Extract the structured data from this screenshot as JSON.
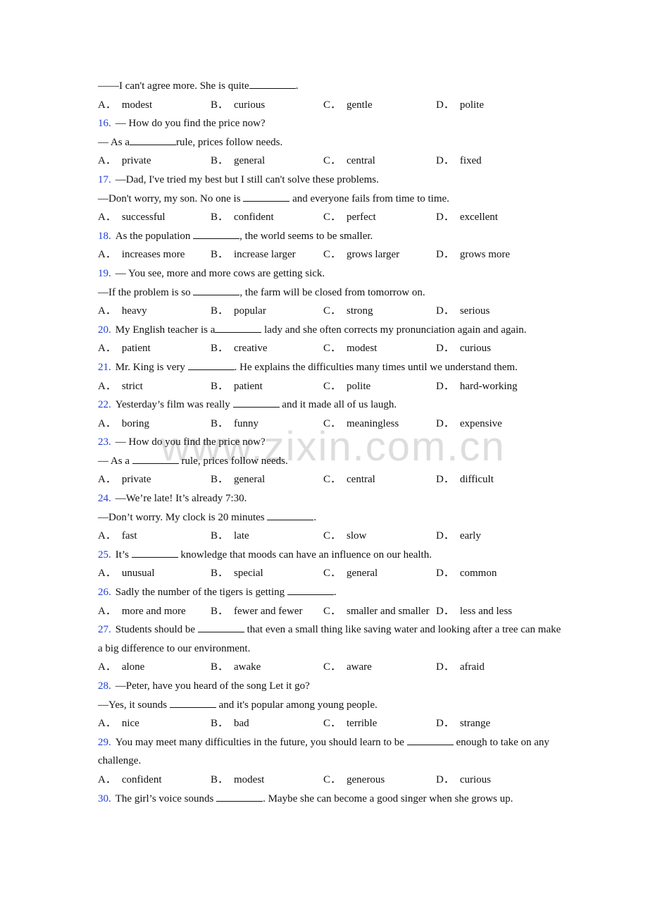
{
  "watermark": "www.zixin.com.cn",
  "intro_line": {
    "before": "——I can't agree more. She is quite",
    "after": "."
  },
  "intro_options": [
    "modest",
    "curious",
    "gentle",
    "polite"
  ],
  "option_letters": [
    "A．",
    "B．",
    "C．",
    "D．"
  ],
  "questions": [
    {
      "number": "16.",
      "lines": [
        {
          "before": "— How do you find the price now?",
          "after": ""
        },
        {
          "before": "— As a",
          "blank": true,
          "after": "rule, prices follow needs."
        }
      ],
      "options": [
        "private",
        "general",
        "central",
        "fixed"
      ]
    },
    {
      "number": "17.",
      "lines": [
        {
          "before": "—Dad, I've tried my best but I still can't solve these problems.",
          "after": ""
        },
        {
          "before": "—Don't worry, my son. No one is ",
          "blank": true,
          "after": " and everyone fails from time to time."
        }
      ],
      "options": [
        "successful",
        "confident",
        "perfect",
        "excellent"
      ]
    },
    {
      "number": "18.",
      "lines": [
        {
          "before": "As the population ",
          "blank": true,
          "after": ", the world seems to be smaller."
        }
      ],
      "options": [
        "increases more",
        "increase larger",
        "grows larger",
        "grows more"
      ]
    },
    {
      "number": "19.",
      "lines": [
        {
          "before": "— You see, more and more cows are getting sick.",
          "after": ""
        },
        {
          "before": "—If the problem is so  ",
          "blank": true,
          "after": ", the farm will be closed from tomorrow on."
        }
      ],
      "options": [
        "heavy",
        "popular",
        "strong",
        "serious"
      ]
    },
    {
      "number": "20.",
      "lines": [
        {
          "before": "My English teacher is a",
          "blank": true,
          "after": " lady and she often corrects my pronunciation again and again.",
          "wrap": true
        }
      ],
      "options": [
        "patient",
        "creative",
        "modest",
        "curious"
      ]
    },
    {
      "number": "21.",
      "lines": [
        {
          "before": "Mr. King is very ",
          "blank": true,
          "after": ". He explains the difficulties many times until we understand them."
        }
      ],
      "options": [
        "strict",
        "patient",
        "polite",
        "hard-working"
      ]
    },
    {
      "number": "22.",
      "lines": [
        {
          "before": "Yesterday’s film was really ",
          "blank": true,
          "after": " and it made all of us laugh."
        }
      ],
      "options": [
        "boring",
        "funny",
        "meaningless",
        "expensive"
      ]
    },
    {
      "number": "23.",
      "lines": [
        {
          "before": "— How do you find the price now?",
          "after": ""
        },
        {
          "before": "— As a ",
          "blank": true,
          "after": " rule, prices follow needs."
        }
      ],
      "options": [
        "private",
        "general",
        "central",
        "difficult"
      ]
    },
    {
      "number": "24.",
      "lines": [
        {
          "before": "—We’re late! It’s already 7:30.",
          "after": ""
        },
        {
          "before": "—Don’t worry. My clock is 20 minutes ",
          "blank": true,
          "after": "."
        }
      ],
      "options": [
        "fast",
        "late",
        "slow",
        "early"
      ]
    },
    {
      "number": "25.",
      "lines": [
        {
          "before": "It’s ",
          "blank": true,
          "after": " knowledge that moods can have an influence on our health."
        }
      ],
      "options": [
        "unusual",
        "special",
        "general",
        "common"
      ]
    },
    {
      "number": "26.",
      "lines": [
        {
          "before": "Sadly the number of the tigers is getting ",
          "blank": true,
          "after": "."
        }
      ],
      "options": [
        "more and more",
        "fewer and fewer",
        "smaller and smaller",
        "less and less"
      ]
    },
    {
      "number": "27.",
      "lines": [
        {
          "before": "Students should be ",
          "blank": true,
          "after": " that even a small thing like saving water and looking after a tree can make a big difference to our environment.",
          "wrap": true
        }
      ],
      "options": [
        "alone",
        "awake",
        "aware",
        "afraid"
      ]
    },
    {
      "number": "28.",
      "lines": [
        {
          "before": "—Peter, have you heard of the song Let it go?",
          "after": ""
        },
        {
          "before": "—Yes, it sounds ",
          "blank": true,
          "after": " and it's popular among young people."
        }
      ],
      "options": [
        "nice",
        "bad",
        "terrible",
        "strange"
      ]
    },
    {
      "number": "29.",
      "lines": [
        {
          "before": "You may meet many difficulties in the future, you should learn to be ",
          "blank": true,
          "after": " enough to take on any challenge.",
          "wrap": true
        }
      ],
      "options": [
        "confident",
        "modest",
        "generous",
        "curious"
      ]
    },
    {
      "number": "30.",
      "lines": [
        {
          "before": "The girl’s voice sounds ",
          "blank": true,
          "after": ". Maybe she can become a good singer when she grows up."
        }
      ],
      "options": []
    }
  ]
}
